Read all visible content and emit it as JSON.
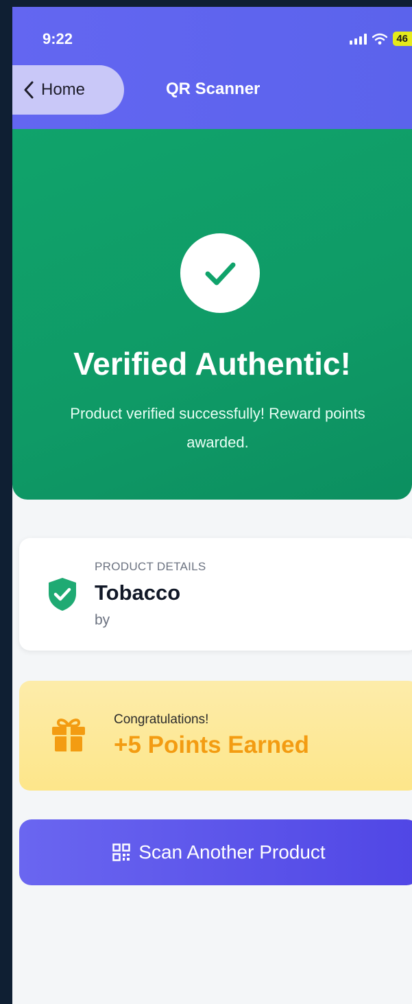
{
  "status": {
    "time": "9:22",
    "battery": "46"
  },
  "nav": {
    "back_label": "Home",
    "title": "QR Scanner"
  },
  "hero": {
    "title": "Verified Authentic!",
    "subtitle_line1": "Product verified successfully! Reward points",
    "subtitle_line2": "awarded."
  },
  "product": {
    "section_label": "PRODUCT DETAILS",
    "name": "Tobacco",
    "by_label": "by"
  },
  "reward": {
    "label": "Congratulations!",
    "points": "+5 Points Earned"
  },
  "actions": {
    "scan_label": "Scan Another Product"
  },
  "colors": {
    "header": "#6366f1",
    "success": "#10a36b",
    "reward_bg": "#fde68a",
    "reward_text": "#f39c12",
    "button": "#5b55ea"
  },
  "icons": [
    "chevron-left-icon",
    "check-icon",
    "shield-check-icon",
    "gift-icon",
    "qr-code-icon",
    "signal-icon",
    "wifi-icon",
    "battery-icon"
  ]
}
